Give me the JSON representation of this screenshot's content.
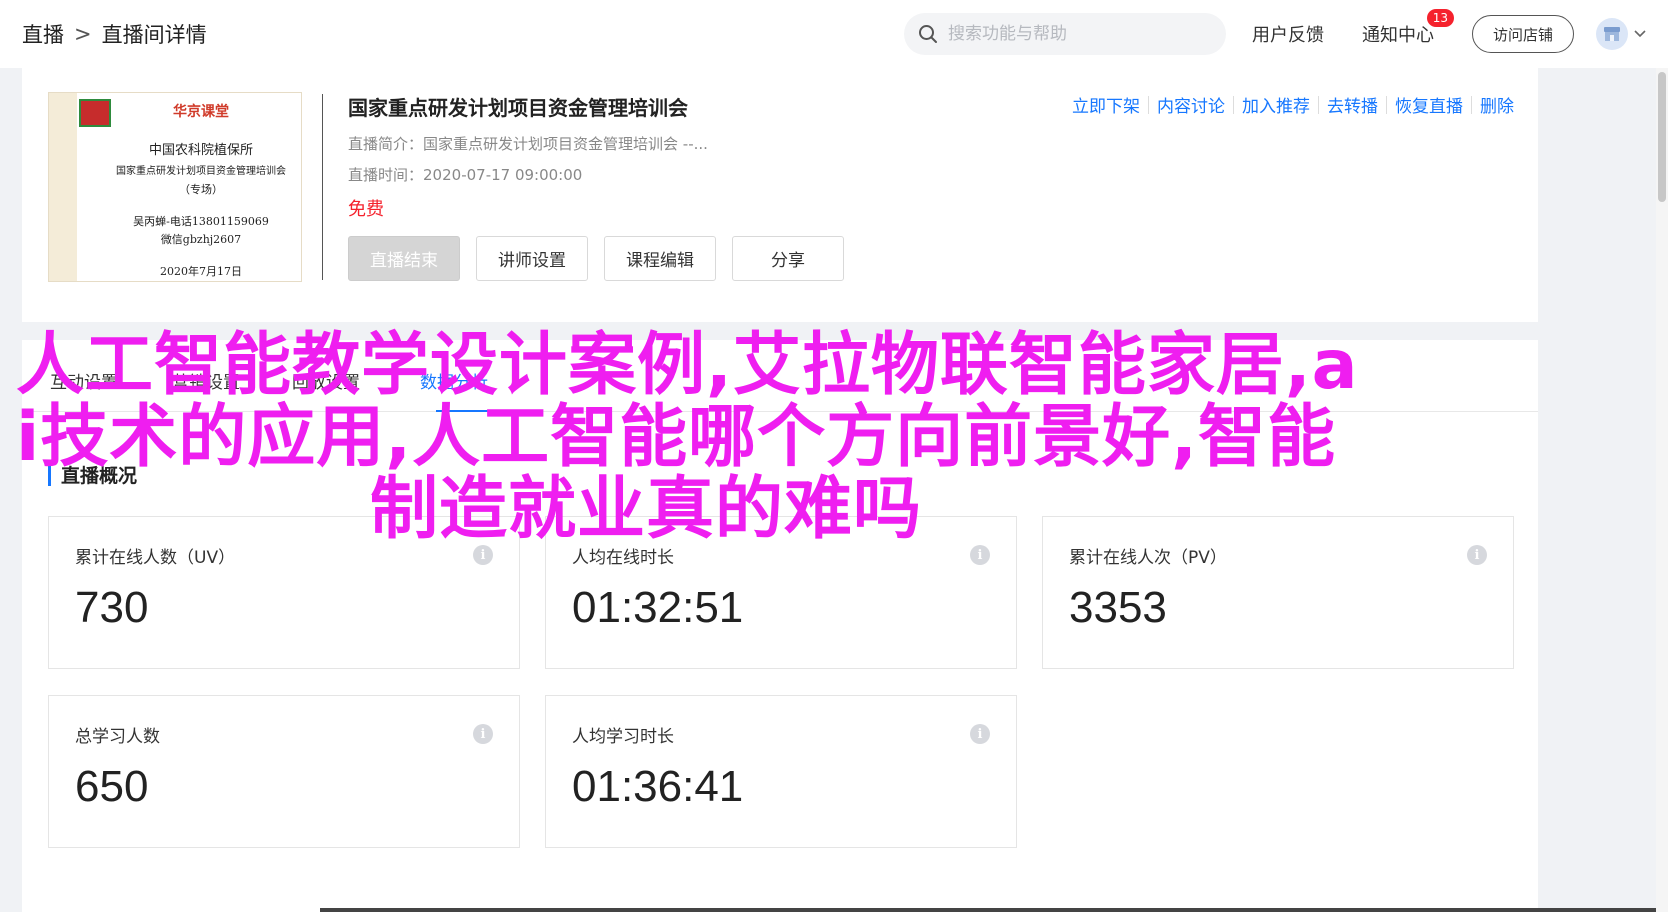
{
  "header": {
    "breadcrumb": [
      "直播",
      "直播间详情"
    ],
    "breadcrumb_sep": ">",
    "search_placeholder": "搜索功能与帮助",
    "feedback": "用户反馈",
    "notifications": "通知中心",
    "notification_count": "13",
    "visit_store": "访问店铺",
    "icons": [
      "search-icon",
      "store-icon",
      "chevron-down-icon"
    ]
  },
  "course": {
    "cover": {
      "brand": "华京课堂",
      "org": "中国农科院植保所",
      "program": "国家重点研发计划项目资金管理培训会",
      "special": "（专场）",
      "contact_name_phone": "吴丙蝉-电话13801159069",
      "wechat": "微信gbzhj2607",
      "date": "2020年7月17日"
    },
    "title": "国家重点研发计划项目资金管理培训会",
    "intro_label": "直播简介：",
    "intro_value": "国家重点研发计划项目资金管理培训会 --...",
    "time_label": "直播时间：",
    "time_value": "2020-07-17 09:00:00",
    "price": "免费",
    "buttons": [
      "直播结束",
      "讲师设置",
      "课程编辑",
      "分享"
    ],
    "operations": [
      "立即下架",
      "内容讨论",
      "加入推荐",
      "去转播",
      "恢复直播",
      "删除"
    ]
  },
  "tabs": [
    "互动设置",
    "营销设置",
    "回放设置",
    "数据分析"
  ],
  "active_tab": "数据分析",
  "overview": {
    "title": "直播概况",
    "cards": [
      {
        "label": "累计在线人数（UV）",
        "value": "730"
      },
      {
        "label": "人均在线时长",
        "value": "01:32:51"
      },
      {
        "label": "累计在线人次（PV）",
        "value": "3353"
      },
      {
        "label": "总学习人数",
        "value": "650"
      },
      {
        "label": "人均学习时长",
        "value": "01:36:41"
      }
    ]
  },
  "overlay": {
    "line1": "人工智能教学设计案例,艾拉物联智能家居,a",
    "line2": "i技术的应用,人工智能哪个方向前景好,智能",
    "line3": "制造就业真的难吗"
  },
  "colors": {
    "accent": "#1677ff",
    "price": "#f5222d",
    "overlay": "#ef1ef0",
    "badge": "#f5222d"
  }
}
